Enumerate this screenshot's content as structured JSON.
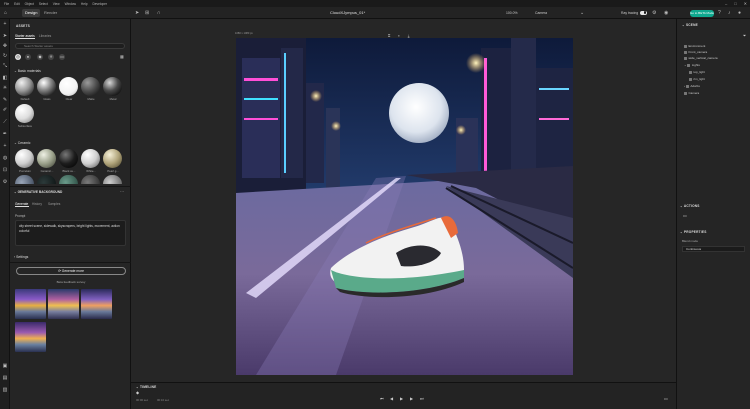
{
  "menu": [
    "File",
    "Edit",
    "Object",
    "Select",
    "View",
    "Window",
    "Help",
    "Developer"
  ],
  "tabs": {
    "design": "Design",
    "render": "Render"
  },
  "document_title": "CloudXJympus_01*",
  "topbar": {
    "zoom": "100.0%",
    "camera": "Camera",
    "ray_tracing": "Ray tracing",
    "beta_button": "Go to BETA Mode"
  },
  "assets": {
    "title": "ASSETS",
    "subtabs": [
      "Starter assets",
      "Libraries"
    ],
    "search_placeholder": "Search Starter assets",
    "basic_materials": {
      "title": "Basic materials",
      "items": [
        "Default",
        "Glass",
        "Clear",
        "Matte",
        "Metal",
        "Subsurface"
      ]
    },
    "ceramic": {
      "title": "Ceramic",
      "items": [
        "Porcelain",
        "Ceramic...",
        "Black ce...",
        "White...",
        "Pearl g..."
      ]
    }
  },
  "generative": {
    "title": "GENERATIVE BACKGROUND",
    "tabs": [
      "Generate",
      "History",
      "Samples"
    ],
    "prompt_label": "Prompt",
    "prompt": "city street scene, sidewalk, skyscrapers, bright lights, movement, action colorful",
    "settings_label": "Settings",
    "generate_button": "Generate more",
    "feedback": "Beta feedback survey"
  },
  "canvas": {
    "size_label": "1080 x 1080 px"
  },
  "scene": {
    "title": "SCENE",
    "items": [
      "Environment",
      "Front_camera",
      "wide_vertical_camera",
      "Lights",
      "top_light",
      "rim_light",
      "Adorbs",
      "Camera"
    ],
    "actions_title": "ACTIONS",
    "properties_title": "PROPERTIES",
    "blend_label": "Blend mode",
    "blend_value": "Continuous"
  },
  "timeline": {
    "title": "TIMELINE",
    "time_current": "00:00 sec",
    "time_total": "00:10 sec"
  },
  "colors": {
    "accent": "#0fa98f",
    "panel": "#252525",
    "background": "#1d1d1d"
  },
  "icons": [
    "home-icon",
    "select-icon",
    "move-icon",
    "camera-icon",
    "light-icon",
    "search-icon",
    "settings-icon",
    "help-icon",
    "bell-icon",
    "play-icon",
    "skip-back-icon",
    "skip-forward-icon"
  ]
}
